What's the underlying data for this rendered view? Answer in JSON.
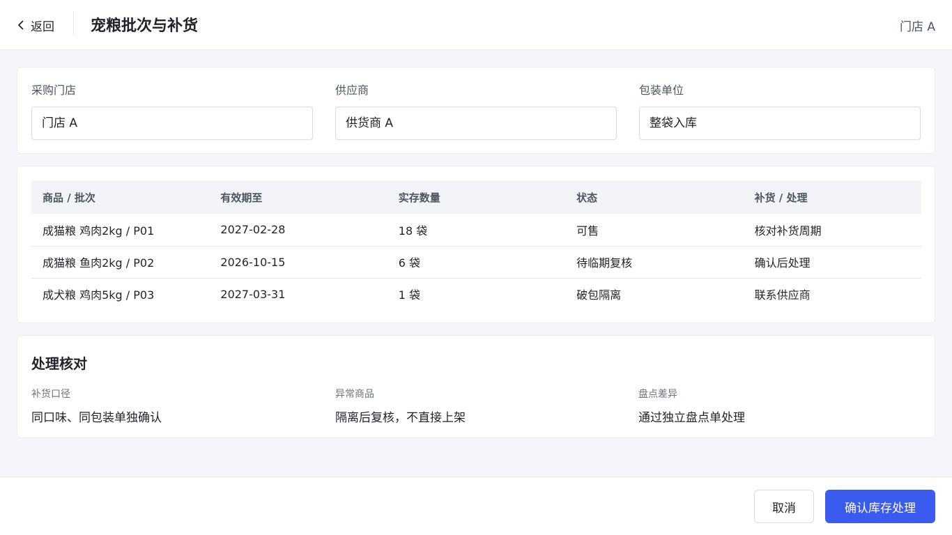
{
  "header": {
    "back_label": "返回",
    "title": "宠粮批次与补货",
    "store": "门店 A"
  },
  "form": {
    "fields": [
      {
        "label": "采购门店",
        "value": "门店 A"
      },
      {
        "label": "供应商",
        "value": "供货商 A"
      },
      {
        "label": "包装单位",
        "value": "整袋入库"
      }
    ]
  },
  "table": {
    "columns": [
      "商品 / 批次",
      "有效期至",
      "实存数量",
      "状态",
      "补货 / 处理"
    ],
    "rows": [
      [
        "成猫粮 鸡肉2kg / P01",
        "2027-02-28",
        "18 袋",
        "可售",
        "核对补货周期"
      ],
      [
        "成猫粮 鱼肉2kg / P02",
        "2026-10-15",
        "6 袋",
        "待临期复核",
        "确认后处理"
      ],
      [
        "成犬粮 鸡肉5kg / P03",
        "2027-03-31",
        "1 袋",
        "破包隔离",
        "联系供应商"
      ]
    ]
  },
  "check": {
    "title": "处理核对",
    "items": [
      {
        "label": "补货口径",
        "value": "同口味、同包装单独确认"
      },
      {
        "label": "异常商品",
        "value": "隔离后复核，不直接上架"
      },
      {
        "label": "盘点差异",
        "value": "通过独立盘点单处理"
      }
    ]
  },
  "footer": {
    "cancel_label": "取消",
    "confirm_label": "确认库存处理"
  },
  "colors": {
    "primary": "#3b5bef",
    "background": "#f4f6fa"
  }
}
